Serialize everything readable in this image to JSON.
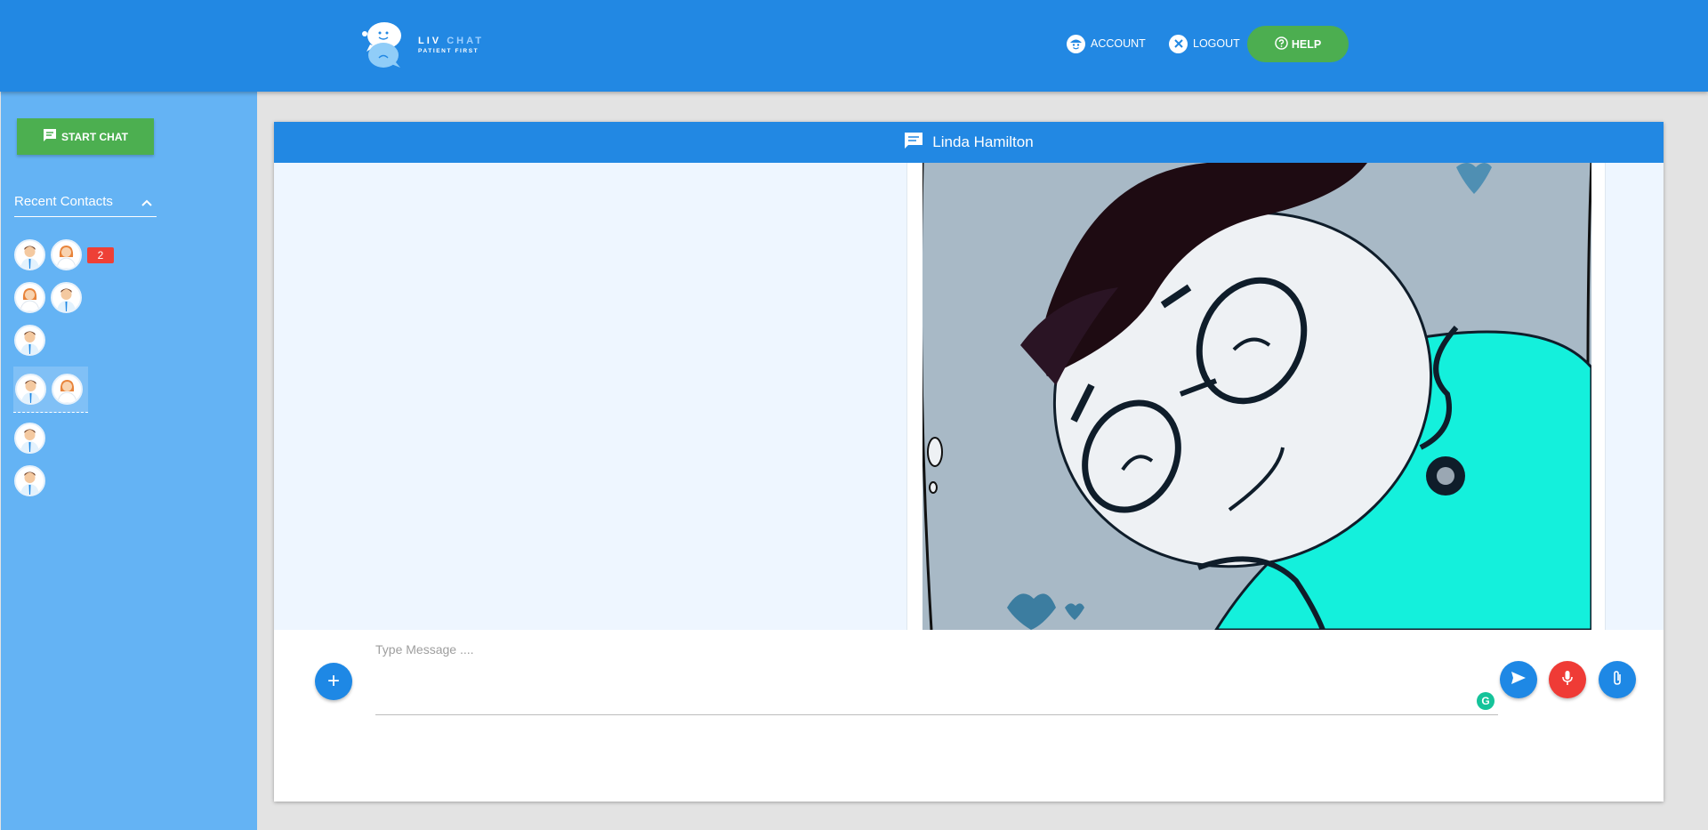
{
  "brand": {
    "name_part1": "LIV",
    "name_part2": "CHAT",
    "tagline": "PATIENT FIRST"
  },
  "header": {
    "nav": [
      {
        "label": "ACCOUNT",
        "icon": "account-face-icon"
      },
      {
        "label": "LOGOUT",
        "icon": "close-circle-icon"
      }
    ],
    "help_label": "HELP"
  },
  "sidebar": {
    "start_chat_label": "START CHAT",
    "recent_contacts_label": "Recent Contacts",
    "contacts": [
      {
        "avatars": [
          "doctor-male",
          "doctor-female"
        ],
        "unread": "2"
      },
      {
        "avatars": [
          "doctor-female",
          "doctor-male"
        ]
      },
      {
        "avatars": [
          "doctor-male"
        ]
      },
      {
        "avatars": [
          "doctor-male",
          "doctor-female"
        ],
        "selected": true
      },
      {
        "avatars": [
          "doctor-male"
        ]
      },
      {
        "avatars": [
          "doctor-male"
        ]
      }
    ]
  },
  "chat": {
    "contact_name": "Linda Hamilton",
    "composer": {
      "placeholder": "Type Message ...."
    }
  },
  "colors": {
    "header": "#2288e3",
    "sidebar": "#64b3f4",
    "green": "#4caf50",
    "red": "#ef3b36",
    "badge": "#ee4036"
  }
}
